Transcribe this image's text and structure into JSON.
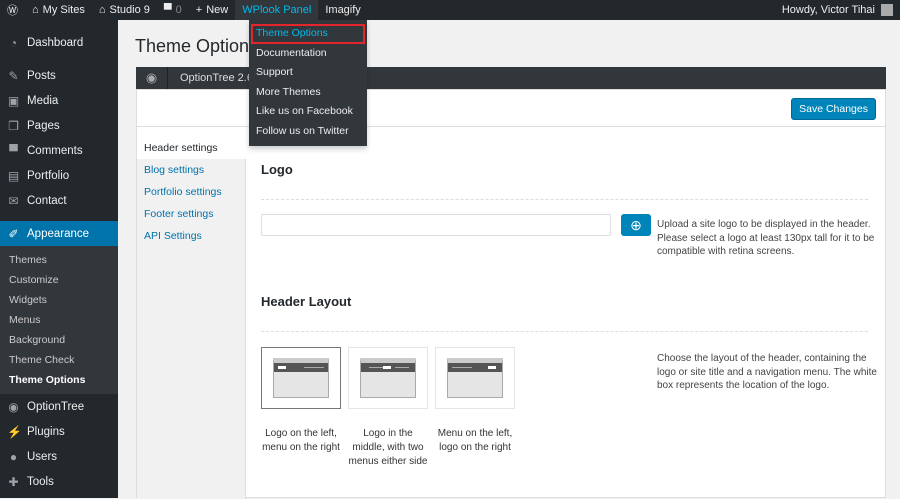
{
  "adminbar": {
    "my_sites": "My Sites",
    "site": "Studio 9",
    "comments": "0",
    "new": "New",
    "panel": "WPlook Panel",
    "imagify": "Imagify",
    "howdy": "Howdy, Victor Tihai"
  },
  "dropdown": [
    "Theme Options",
    "Documentation",
    "Support",
    "More Themes",
    "Like us on Facebook",
    "Follow us on Twitter"
  ],
  "sidebar": {
    "items": [
      {
        "label": "Dashboard",
        "icon": "dashboard-icon"
      },
      {
        "label": "Posts",
        "icon": "pin-icon"
      },
      {
        "label": "Media",
        "icon": "media-icon"
      },
      {
        "label": "Pages",
        "icon": "pages-icon"
      },
      {
        "label": "Comments",
        "icon": "comment-icon"
      },
      {
        "label": "Portfolio",
        "icon": "portfolio-icon"
      },
      {
        "label": "Contact",
        "icon": "mail-icon"
      },
      {
        "label": "Appearance",
        "icon": "brush-icon"
      }
    ],
    "sub": [
      "Themes",
      "Customize",
      "Widgets",
      "Menus",
      "Background",
      "Theme Check",
      "Theme Options"
    ],
    "after": [
      {
        "label": "OptionTree",
        "icon": "optiontree-icon"
      },
      {
        "label": "Plugins",
        "icon": "plugin-icon"
      },
      {
        "label": "Users",
        "icon": "users-icon"
      },
      {
        "label": "Tools",
        "icon": "tools-icon"
      }
    ]
  },
  "page": {
    "title": "Theme Options",
    "optiontree": "OptionTree 2.6.0",
    "save": "Save Changes"
  },
  "tabs": [
    "Header settings",
    "Blog settings",
    "Portfolio settings",
    "Footer settings",
    "API Settings"
  ],
  "logo": {
    "heading": "Logo",
    "value": "",
    "desc": "Upload a site logo to be displayed in the header. Please select a logo at least 130px tall for it to be compatible with retina screens."
  },
  "layout": {
    "heading": "Header Layout",
    "desc": "Choose the layout of the header, containing the logo or site title and a navigation menu. The white box represents the location of the logo.",
    "selected": 0,
    "options": [
      "Logo on the left, menu on the right",
      "Logo in the middle, with two menus either side",
      "Menu on the left, logo on the right"
    ]
  }
}
